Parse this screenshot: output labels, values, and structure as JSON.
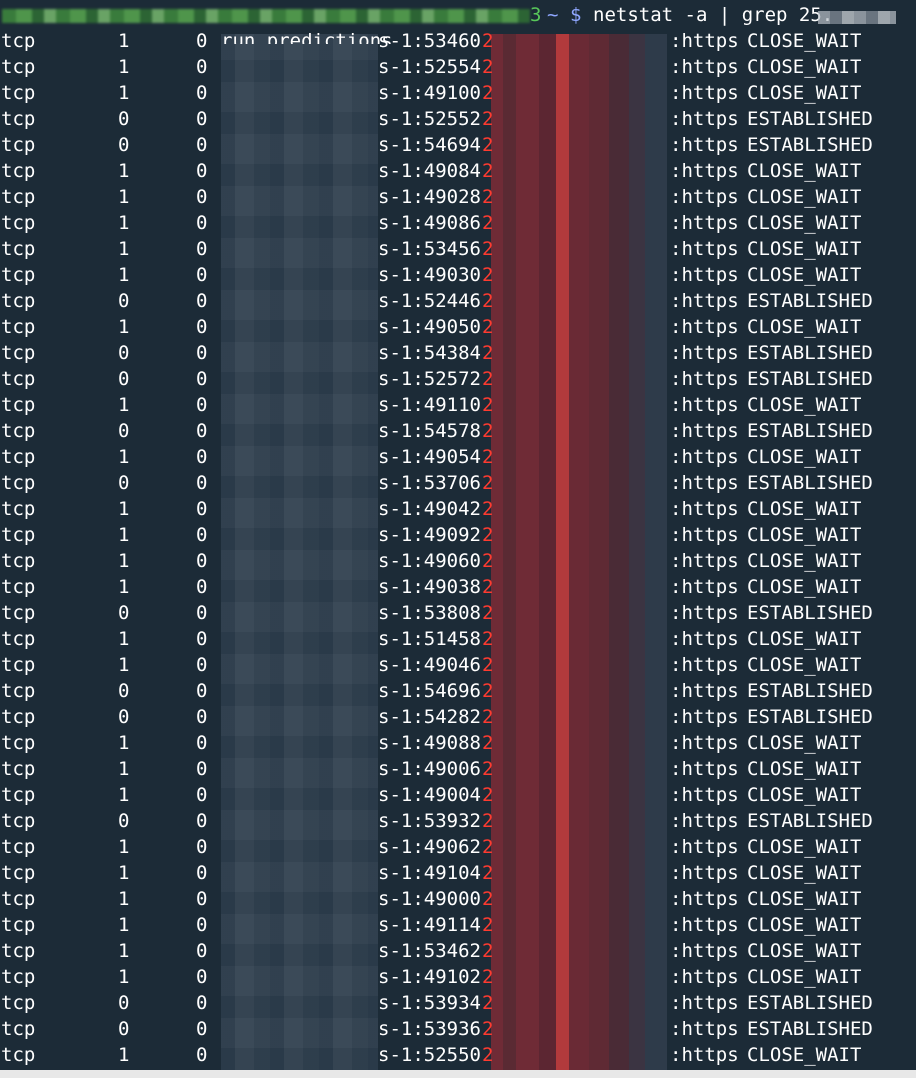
{
  "terminal": {
    "prompt_tail": "3",
    "prompt_tilde": "~",
    "prompt_dollar": "$",
    "command": "netstat -a | grep 25.",
    "first_local_visible": "run.predictions",
    "foreign_prefix": "2",
    "colors": {
      "background": "#1c2b37",
      "text": "#ffffff",
      "prompt_green": "#58c75a",
      "prompt_blue": "#8fa7ff",
      "foreign_red": "#ff3b30"
    }
  },
  "rows": [
    {
      "proto": "tcp",
      "recv_q": "1",
      "send_q": "0",
      "local_tail": "s-1:53460",
      "foreign_tail": ":https",
      "state": "CLOSE_WAIT"
    },
    {
      "proto": "tcp",
      "recv_q": "1",
      "send_q": "0",
      "local_tail": "s-1:52554",
      "foreign_tail": ":https",
      "state": "CLOSE_WAIT"
    },
    {
      "proto": "tcp",
      "recv_q": "1",
      "send_q": "0",
      "local_tail": "s-1:49100",
      "foreign_tail": ":https",
      "state": "CLOSE_WAIT"
    },
    {
      "proto": "tcp",
      "recv_q": "0",
      "send_q": "0",
      "local_tail": "s-1:52552",
      "foreign_tail": ":https",
      "state": "ESTABLISHED"
    },
    {
      "proto": "tcp",
      "recv_q": "0",
      "send_q": "0",
      "local_tail": "s-1:54694",
      "foreign_tail": ":https",
      "state": "ESTABLISHED"
    },
    {
      "proto": "tcp",
      "recv_q": "1",
      "send_q": "0",
      "local_tail": "s-1:49084",
      "foreign_tail": ":https",
      "state": "CLOSE_WAIT"
    },
    {
      "proto": "tcp",
      "recv_q": "1",
      "send_q": "0",
      "local_tail": "s-1:49028",
      "foreign_tail": ":https",
      "state": "CLOSE_WAIT"
    },
    {
      "proto": "tcp",
      "recv_q": "1",
      "send_q": "0",
      "local_tail": "s-1:49086",
      "foreign_tail": ":https",
      "state": "CLOSE_WAIT"
    },
    {
      "proto": "tcp",
      "recv_q": "1",
      "send_q": "0",
      "local_tail": "s-1:53456",
      "foreign_tail": ":https",
      "state": "CLOSE_WAIT"
    },
    {
      "proto": "tcp",
      "recv_q": "1",
      "send_q": "0",
      "local_tail": "s-1:49030",
      "foreign_tail": ":https",
      "state": "CLOSE_WAIT"
    },
    {
      "proto": "tcp",
      "recv_q": "0",
      "send_q": "0",
      "local_tail": "s-1:52446",
      "foreign_tail": ":https",
      "state": "ESTABLISHED"
    },
    {
      "proto": "tcp",
      "recv_q": "1",
      "send_q": "0",
      "local_tail": "s-1:49050",
      "foreign_tail": ":https",
      "state": "CLOSE_WAIT"
    },
    {
      "proto": "tcp",
      "recv_q": "0",
      "send_q": "0",
      "local_tail": "s-1:54384",
      "foreign_tail": ":https",
      "state": "ESTABLISHED"
    },
    {
      "proto": "tcp",
      "recv_q": "0",
      "send_q": "0",
      "local_tail": "s-1:52572",
      "foreign_tail": ":https",
      "state": "ESTABLISHED"
    },
    {
      "proto": "tcp",
      "recv_q": "1",
      "send_q": "0",
      "local_tail": "s-1:49110",
      "foreign_tail": ":https",
      "state": "CLOSE_WAIT"
    },
    {
      "proto": "tcp",
      "recv_q": "0",
      "send_q": "0",
      "local_tail": "s-1:54578",
      "foreign_tail": ":https",
      "state": "ESTABLISHED"
    },
    {
      "proto": "tcp",
      "recv_q": "1",
      "send_q": "0",
      "local_tail": "s-1:49054",
      "foreign_tail": ":https",
      "state": "CLOSE_WAIT"
    },
    {
      "proto": "tcp",
      "recv_q": "0",
      "send_q": "0",
      "local_tail": "s-1:53706",
      "foreign_tail": ":https",
      "state": "ESTABLISHED"
    },
    {
      "proto": "tcp",
      "recv_q": "1",
      "send_q": "0",
      "local_tail": "s-1:49042",
      "foreign_tail": ":https",
      "state": "CLOSE_WAIT"
    },
    {
      "proto": "tcp",
      "recv_q": "1",
      "send_q": "0",
      "local_tail": "s-1:49092",
      "foreign_tail": ":https",
      "state": "CLOSE_WAIT"
    },
    {
      "proto": "tcp",
      "recv_q": "1",
      "send_q": "0",
      "local_tail": "s-1:49060",
      "foreign_tail": ":https",
      "state": "CLOSE_WAIT"
    },
    {
      "proto": "tcp",
      "recv_q": "1",
      "send_q": "0",
      "local_tail": "s-1:49038",
      "foreign_tail": ":https",
      "state": "CLOSE_WAIT"
    },
    {
      "proto": "tcp",
      "recv_q": "0",
      "send_q": "0",
      "local_tail": "s-1:53808",
      "foreign_tail": ":https",
      "state": "ESTABLISHED"
    },
    {
      "proto": "tcp",
      "recv_q": "1",
      "send_q": "0",
      "local_tail": "s-1:51458",
      "foreign_tail": ":https",
      "state": "CLOSE_WAIT"
    },
    {
      "proto": "tcp",
      "recv_q": "1",
      "send_q": "0",
      "local_tail": "s-1:49046",
      "foreign_tail": ":https",
      "state": "CLOSE_WAIT"
    },
    {
      "proto": "tcp",
      "recv_q": "0",
      "send_q": "0",
      "local_tail": "s-1:54696",
      "foreign_tail": ":https",
      "state": "ESTABLISHED"
    },
    {
      "proto": "tcp",
      "recv_q": "0",
      "send_q": "0",
      "local_tail": "s-1:54282",
      "foreign_tail": ":https",
      "state": "ESTABLISHED"
    },
    {
      "proto": "tcp",
      "recv_q": "1",
      "send_q": "0",
      "local_tail": "s-1:49088",
      "foreign_tail": ":https",
      "state": "CLOSE_WAIT"
    },
    {
      "proto": "tcp",
      "recv_q": "1",
      "send_q": "0",
      "local_tail": "s-1:49006",
      "foreign_tail": ":https",
      "state": "CLOSE_WAIT"
    },
    {
      "proto": "tcp",
      "recv_q": "1",
      "send_q": "0",
      "local_tail": "s-1:49004",
      "foreign_tail": ":https",
      "state": "CLOSE_WAIT"
    },
    {
      "proto": "tcp",
      "recv_q": "0",
      "send_q": "0",
      "local_tail": "s-1:53932",
      "foreign_tail": ":https",
      "state": "ESTABLISHED"
    },
    {
      "proto": "tcp",
      "recv_q": "1",
      "send_q": "0",
      "local_tail": "s-1:49062",
      "foreign_tail": ":https",
      "state": "CLOSE_WAIT"
    },
    {
      "proto": "tcp",
      "recv_q": "1",
      "send_q": "0",
      "local_tail": "s-1:49104",
      "foreign_tail": ":https",
      "state": "CLOSE_WAIT"
    },
    {
      "proto": "tcp",
      "recv_q": "1",
      "send_q": "0",
      "local_tail": "s-1:49000",
      "foreign_tail": ":https",
      "state": "CLOSE_WAIT"
    },
    {
      "proto": "tcp",
      "recv_q": "1",
      "send_q": "0",
      "local_tail": "s-1:49114",
      "foreign_tail": ":https",
      "state": "CLOSE_WAIT"
    },
    {
      "proto": "tcp",
      "recv_q": "1",
      "send_q": "0",
      "local_tail": "s-1:53462",
      "foreign_tail": ":https",
      "state": "CLOSE_WAIT"
    },
    {
      "proto": "tcp",
      "recv_q": "1",
      "send_q": "0",
      "local_tail": "s-1:49102",
      "foreign_tail": ":https",
      "state": "CLOSE_WAIT"
    },
    {
      "proto": "tcp",
      "recv_q": "0",
      "send_q": "0",
      "local_tail": "s-1:53934",
      "foreign_tail": ":https",
      "state": "ESTABLISHED"
    },
    {
      "proto": "tcp",
      "recv_q": "0",
      "send_q": "0",
      "local_tail": "s-1:53936",
      "foreign_tail": ":https",
      "state": "ESTABLISHED"
    },
    {
      "proto": "tcp",
      "recv_q": "1",
      "send_q": "0",
      "local_tail": "s-1:52550",
      "foreign_tail": ":https",
      "state": "CLOSE_WAIT"
    }
  ]
}
